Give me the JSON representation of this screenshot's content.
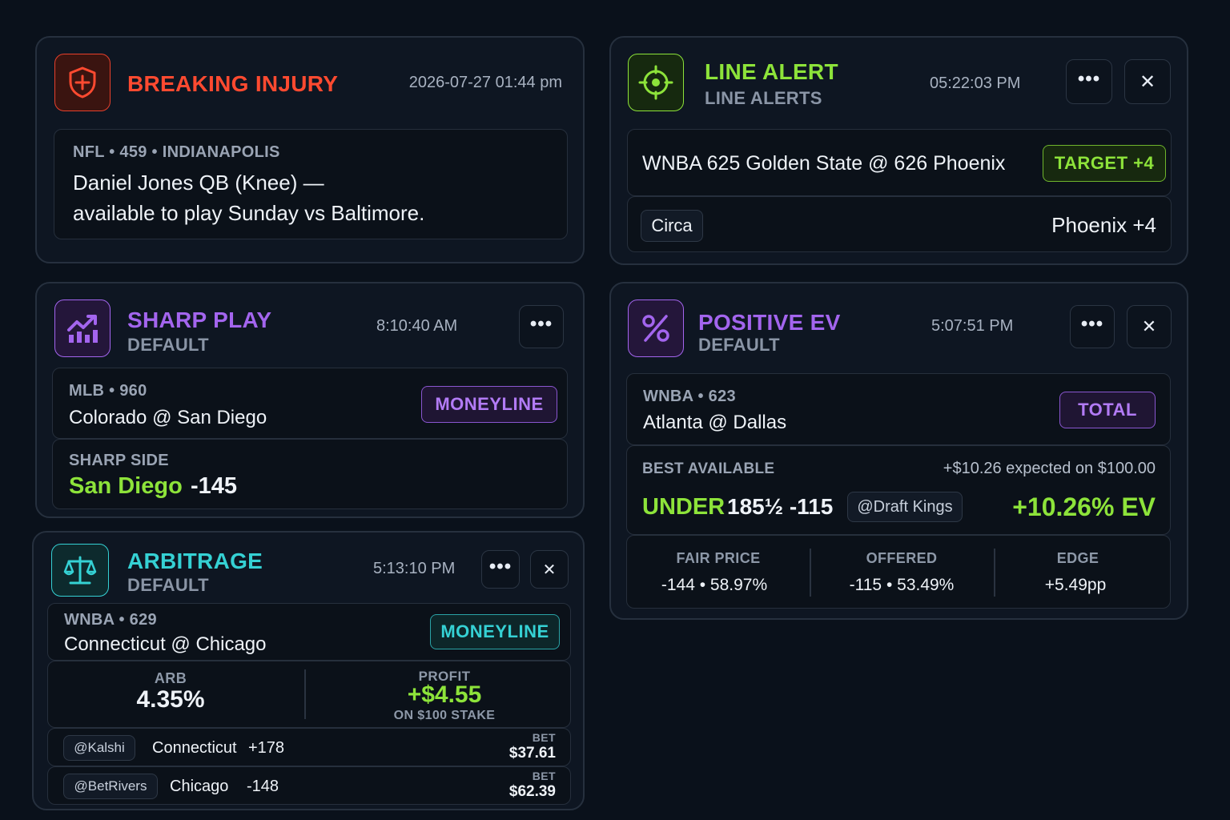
{
  "colors": {
    "injury": "#e8402c",
    "line_alert": "#8de33a",
    "sharp": "#a365ee",
    "ev": "#a365ee",
    "arb": "#35d1d4",
    "positive": "#8de33a"
  },
  "injury": {
    "icon": "shield-plus-icon",
    "title": "BREAKING INJURY",
    "time": "2026-07-27 01:44 pm",
    "meta": "NFL • 459 • INDIANAPOLIS",
    "line1": "Daniel Jones QB (Knee) —",
    "line2": "available to play Sunday vs Baltimore."
  },
  "line_alert": {
    "icon": "crosshair-icon",
    "title": "LINE ALERT",
    "subtitle": "LINE ALERTS",
    "time": "05:22:03 PM",
    "more": "•••",
    "close": "✕",
    "game": "WNBA 625 Golden State @ 626 Phoenix",
    "target": "TARGET +4",
    "book": "Circa",
    "line": "Phoenix +4"
  },
  "sharp": {
    "icon": "trending-chart-icon",
    "title": "SHARP PLAY",
    "subtitle": "DEFAULT",
    "time": "8:10:40 AM",
    "more": "•••",
    "meta": "MLB • 960",
    "game": "Colorado @ San Diego",
    "market": "MONEYLINE",
    "side_label": "SHARP SIDE",
    "side_team": "San Diego",
    "side_odds": "-145"
  },
  "arb": {
    "icon": "scales-icon",
    "title": "ARBITRAGE",
    "subtitle": "DEFAULT",
    "time": "5:13:10 PM",
    "more": "•••",
    "close": "✕",
    "meta": "WNBA • 629",
    "game": "Connecticut @ Chicago",
    "market": "MONEYLINE",
    "arb_label": "ARB",
    "arb_value": "4.35%",
    "profit_label": "PROFIT",
    "profit_value": "+$4.55",
    "profit_note": "ON $100 STAKE",
    "legs": [
      {
        "book": "@Kalshi",
        "team": "Connecticut",
        "odds": "+178",
        "bet_label": "BET",
        "bet": "$37.61"
      },
      {
        "book": "@BetRivers",
        "team": "Chicago",
        "odds": "-148",
        "bet_label": "BET",
        "bet": "$62.39"
      }
    ]
  },
  "ev": {
    "icon": "percent-icon",
    "title": "POSITIVE EV",
    "subtitle": "DEFAULT",
    "time": "5:07:51 PM",
    "more": "•••",
    "close": "✕",
    "meta": "WNBA • 623",
    "game": "Atlanta @ Dallas",
    "market": "TOTAL",
    "best_label": "BEST AVAILABLE",
    "expected": "+$10.26 expected on $100.00",
    "pick_side": "UNDER",
    "pick_line": "185½ -115",
    "book": "@Draft Kings",
    "ev_value": "+10.26% EV",
    "stats": [
      {
        "label": "FAIR PRICE",
        "value": "-144 • 58.97%"
      },
      {
        "label": "OFFERED",
        "value": "-115 • 53.49%"
      },
      {
        "label": "EDGE",
        "value": "+5.49pp"
      }
    ]
  }
}
